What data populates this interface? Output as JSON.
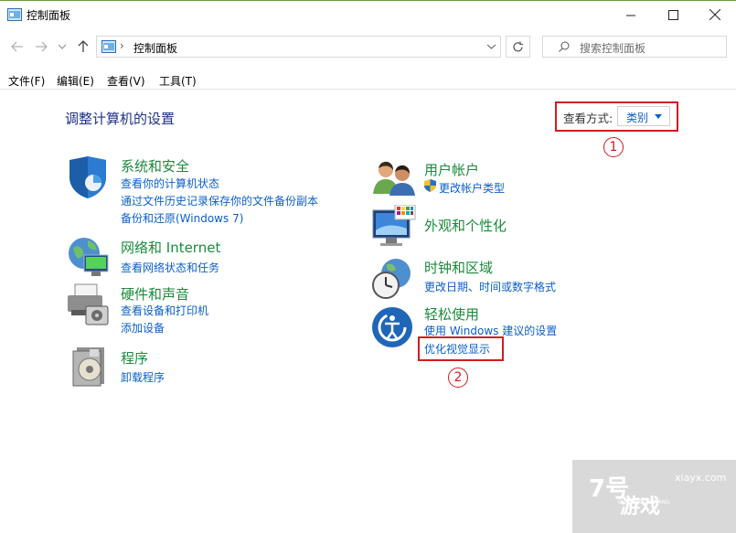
{
  "window": {
    "title": "控制面板"
  },
  "address": {
    "path": "控制面板"
  },
  "search": {
    "placeholder": "搜索控制面板"
  },
  "menu": [
    "文件(F)",
    "编辑(E)",
    "查看(V)",
    "工具(T)"
  ],
  "content": {
    "heading": "调整计算机的设置",
    "view_by_label": "查看方式:",
    "view_by_value": "类别"
  },
  "categories_left": [
    {
      "title": "系统和安全",
      "links": [
        "查看你的计算机状态",
        "通过文件历史记录保存你的文件备份副本",
        "备份和还原(Windows 7)"
      ]
    },
    {
      "title": "网络和 Internet",
      "links": [
        "查看网络状态和任务"
      ]
    },
    {
      "title": "硬件和声音",
      "links": [
        "查看设备和打印机",
        "添加设备"
      ]
    },
    {
      "title": "程序",
      "links": [
        "卸载程序"
      ]
    }
  ],
  "categories_right": [
    {
      "title": "用户帐户",
      "links": [
        "更改帐户类型"
      ]
    },
    {
      "title": "外观和个性化",
      "links": []
    },
    {
      "title": "时钟和区域",
      "links": [
        "更改日期、时间或数字格式"
      ]
    },
    {
      "title": "轻松使用",
      "links": [
        "使用 Windows 建议的设置",
        "优化视觉显示"
      ]
    }
  ],
  "annotations": {
    "marker1": "1",
    "marker2": "2"
  },
  "watermark": {
    "number": "7号",
    "name": "游戏",
    "sub": "QIHAOYOUXIWANG",
    "url": "xiayx.com"
  },
  "colors": {
    "accent_link": "#0b5fcc",
    "category_green": "#1b8a3a",
    "annotation_red": "#d01d1d"
  }
}
